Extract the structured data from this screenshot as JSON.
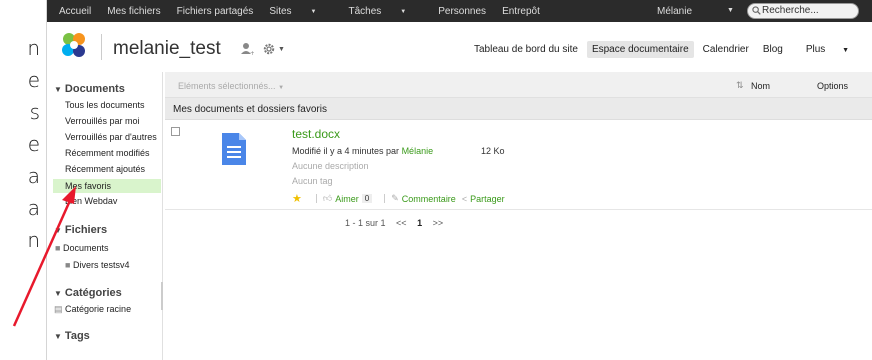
{
  "left_text": [
    "n",
    "e",
    "s",
    "e",
    "a",
    "a",
    "n"
  ],
  "topbar": {
    "items": [
      "Accueil",
      "Mes fichiers",
      "Fichiers partagés",
      "Sites",
      "Tâches",
      "Personnes",
      "Entrepôt"
    ],
    "user": "Mélanie",
    "search_placeholder": "Recherche..."
  },
  "site": {
    "title": "melanie_test",
    "nav": [
      "Tableau de bord du site",
      "Espace documentaire",
      "Calendrier",
      "Blog",
      "Plus"
    ]
  },
  "sidebar": {
    "documents_heading": "Documents",
    "documents_items": [
      "Tous les documents",
      "Verrouillés par moi",
      "Verrouillés par d'autres",
      "Récemment modifiés",
      "Récemment ajoutés",
      "Mes favoris",
      "Lien Webdav"
    ],
    "files_heading": "Fichiers",
    "files_items": [
      "Documents",
      "Divers testsv4"
    ],
    "categories_heading": "Catégories",
    "categories_item": "Catégorie racine",
    "tags_heading": "Tags"
  },
  "toolbar": {
    "selected_items": "Eléments sélectionnés...",
    "sort_label": "Nom",
    "options_label": "Options"
  },
  "list": {
    "header": "Mes documents et dossiers favoris",
    "document": {
      "name": "test.docx",
      "modified_prefix": "Modifié il y a 4 minutes par",
      "modified_user": "Mélanie",
      "size": "12 Ko",
      "description": "Aucune description",
      "tags": "Aucun tag",
      "like_label": "Aimer",
      "like_count": "0",
      "comment_label": "Commentaire",
      "share_label": "Partager"
    }
  },
  "pagination": {
    "range": "1 - 1 sur 1",
    "prev": "<<",
    "current": "1",
    "next": ">>"
  },
  "colors": {
    "accent_green": "#3a9a1a",
    "highlight": "#d9f4cc",
    "arrow": "#e8192c",
    "topbar": "#2b2b2b"
  }
}
